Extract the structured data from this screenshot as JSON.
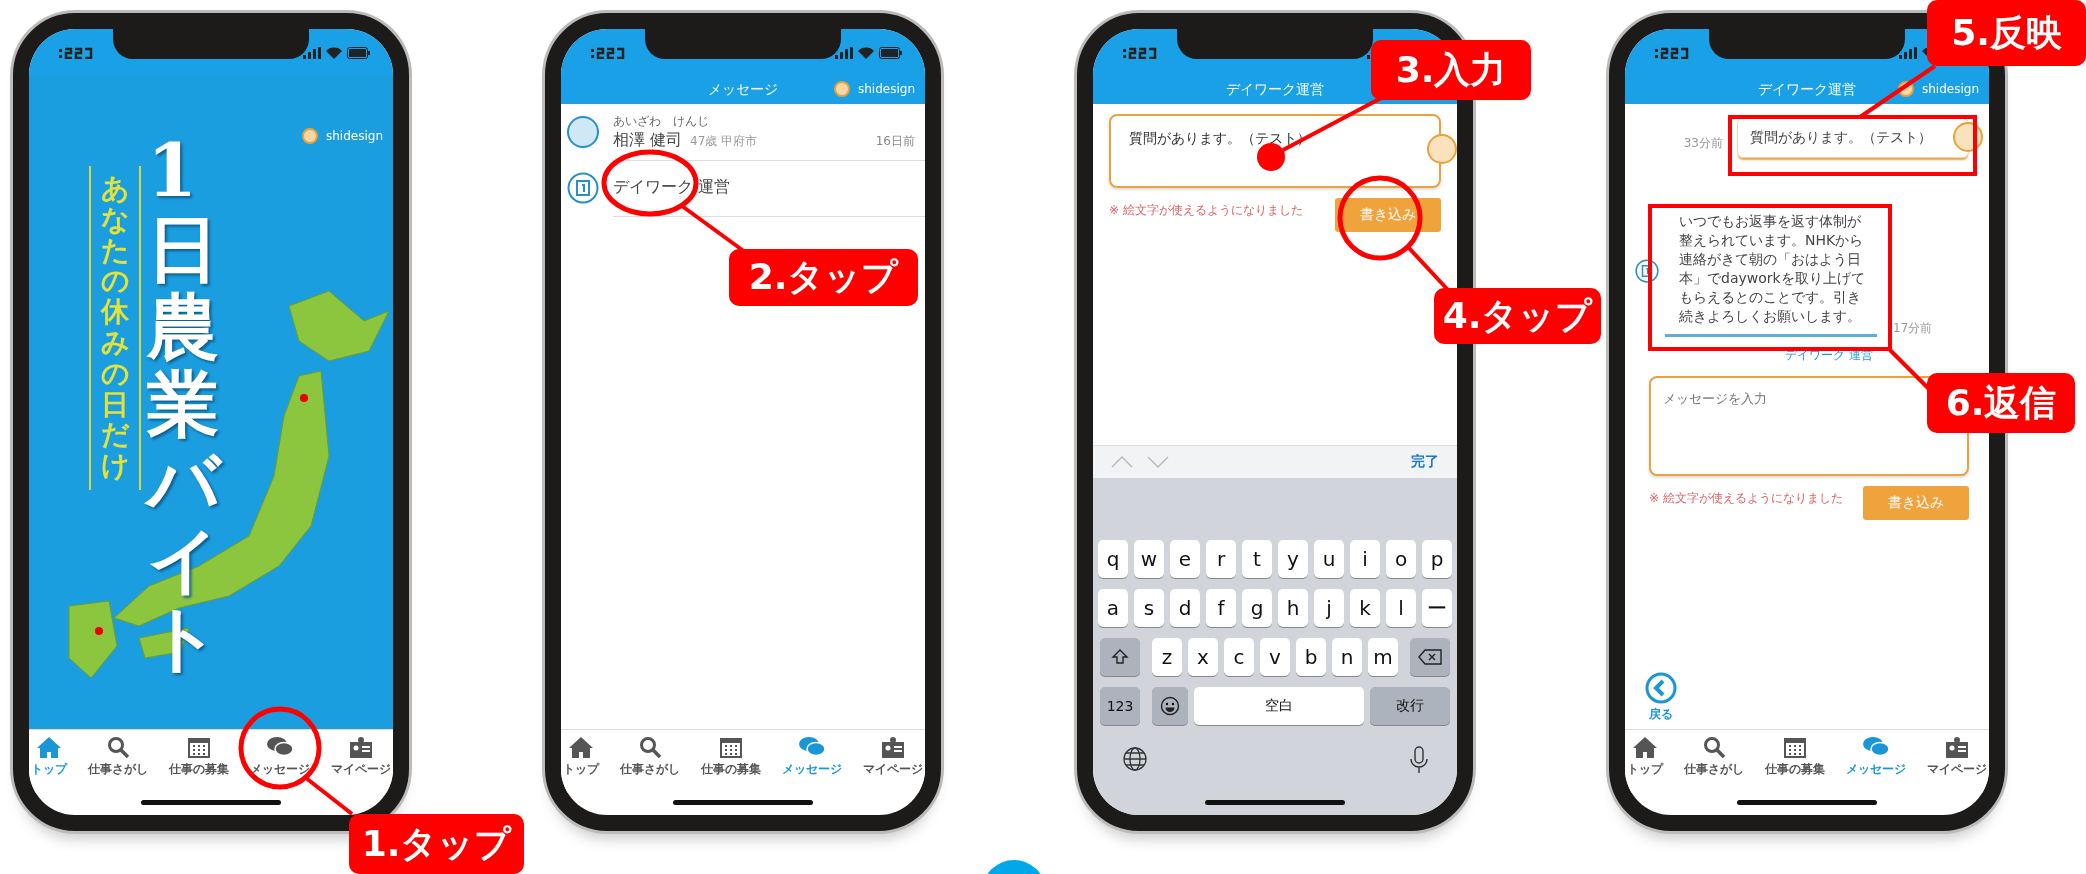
{
  "phones": [
    {
      "kind": "poster",
      "header": {
        "user": "shidesign"
      },
      "poster": {
        "title": "1日農業バイト",
        "subtitle": "あなたの休みの日だけ"
      },
      "tabbar": [
        {
          "label": "トップ",
          "selected": true
        },
        {
          "label": "仕事さがし",
          "selected": false
        },
        {
          "label": "仕事の募集",
          "selected": false
        },
        {
          "label": "メッセージ",
          "selected": false
        },
        {
          "label": "マイページ",
          "selected": false
        }
      ]
    },
    {
      "kind": "message_list",
      "header": {
        "title": "メッセージ",
        "user": "shidesign"
      },
      "threads": [
        {
          "ruby": "あいざわ　けんじ",
          "name": "相澤 健司",
          "meta": "47歳 甲府市",
          "time": "16日前"
        },
        {
          "name": "デイワーク 運営"
        }
      ],
      "tabbar": [
        {
          "label": "トップ",
          "selected": false
        },
        {
          "label": "仕事さがし",
          "selected": false
        },
        {
          "label": "仕事の募集",
          "selected": false
        },
        {
          "label": "メッセージ",
          "selected": true
        },
        {
          "label": "マイページ",
          "selected": false
        }
      ]
    },
    {
      "kind": "compose",
      "header": {
        "title": "デイワーク運営"
      },
      "input": {
        "value": "質問があります。（テスト）"
      },
      "note": "※ 絵文字が使えるようになりました",
      "button": "書き込み",
      "keyboard": {
        "done": "完了",
        "rows": [
          [
            "q",
            "w",
            "e",
            "r",
            "t",
            "y",
            "u",
            "i",
            "o",
            "p"
          ],
          [
            "a",
            "s",
            "d",
            "f",
            "g",
            "h",
            "j",
            "k",
            "l",
            "ー"
          ],
          [
            "z",
            "x",
            "c",
            "v",
            "b",
            "n",
            "m"
          ]
        ],
        "numbers": "123",
        "space": "空白",
        "return": "改行"
      }
    },
    {
      "kind": "chat",
      "header": {
        "title": "デイワーク運営",
        "user": "shidesign"
      },
      "messages": [
        {
          "kind": "mine",
          "text": "質問があります。（テスト）",
          "time": "33分前"
        },
        {
          "kind": "theirs",
          "text": "いつでもお返事を返す体制が整えられています。NHKから連絡がきて朝の「おはよう日本」でdayworkを取り上げてもらえるとのことです。引き続きよろしくお願いします。",
          "time": "17分前",
          "sender": "デイワーク 運営"
        }
      ],
      "input": {
        "placeholder": "メッセージを入力"
      },
      "note": "※ 絵文字が使えるようになりました",
      "button": "書き込み",
      "back": "戻る",
      "tabbar": [
        {
          "label": "トップ",
          "selected": false
        },
        {
          "label": "仕事さがし",
          "selected": false
        },
        {
          "label": "仕事の募集",
          "selected": false
        },
        {
          "label": "メッセージ",
          "selected": true
        },
        {
          "label": "マイページ",
          "selected": false
        }
      ]
    }
  ],
  "callouts": [
    {
      "label": "1.タップ",
      "kind": "circle"
    },
    {
      "label": "2.タップ",
      "kind": "circle"
    },
    {
      "label": "3.入力",
      "kind": "dot"
    },
    {
      "label": "4.タップ",
      "kind": "circle"
    },
    {
      "label": "5.反映",
      "kind": "frame"
    },
    {
      "label": "6.返信",
      "kind": "frame"
    }
  ]
}
